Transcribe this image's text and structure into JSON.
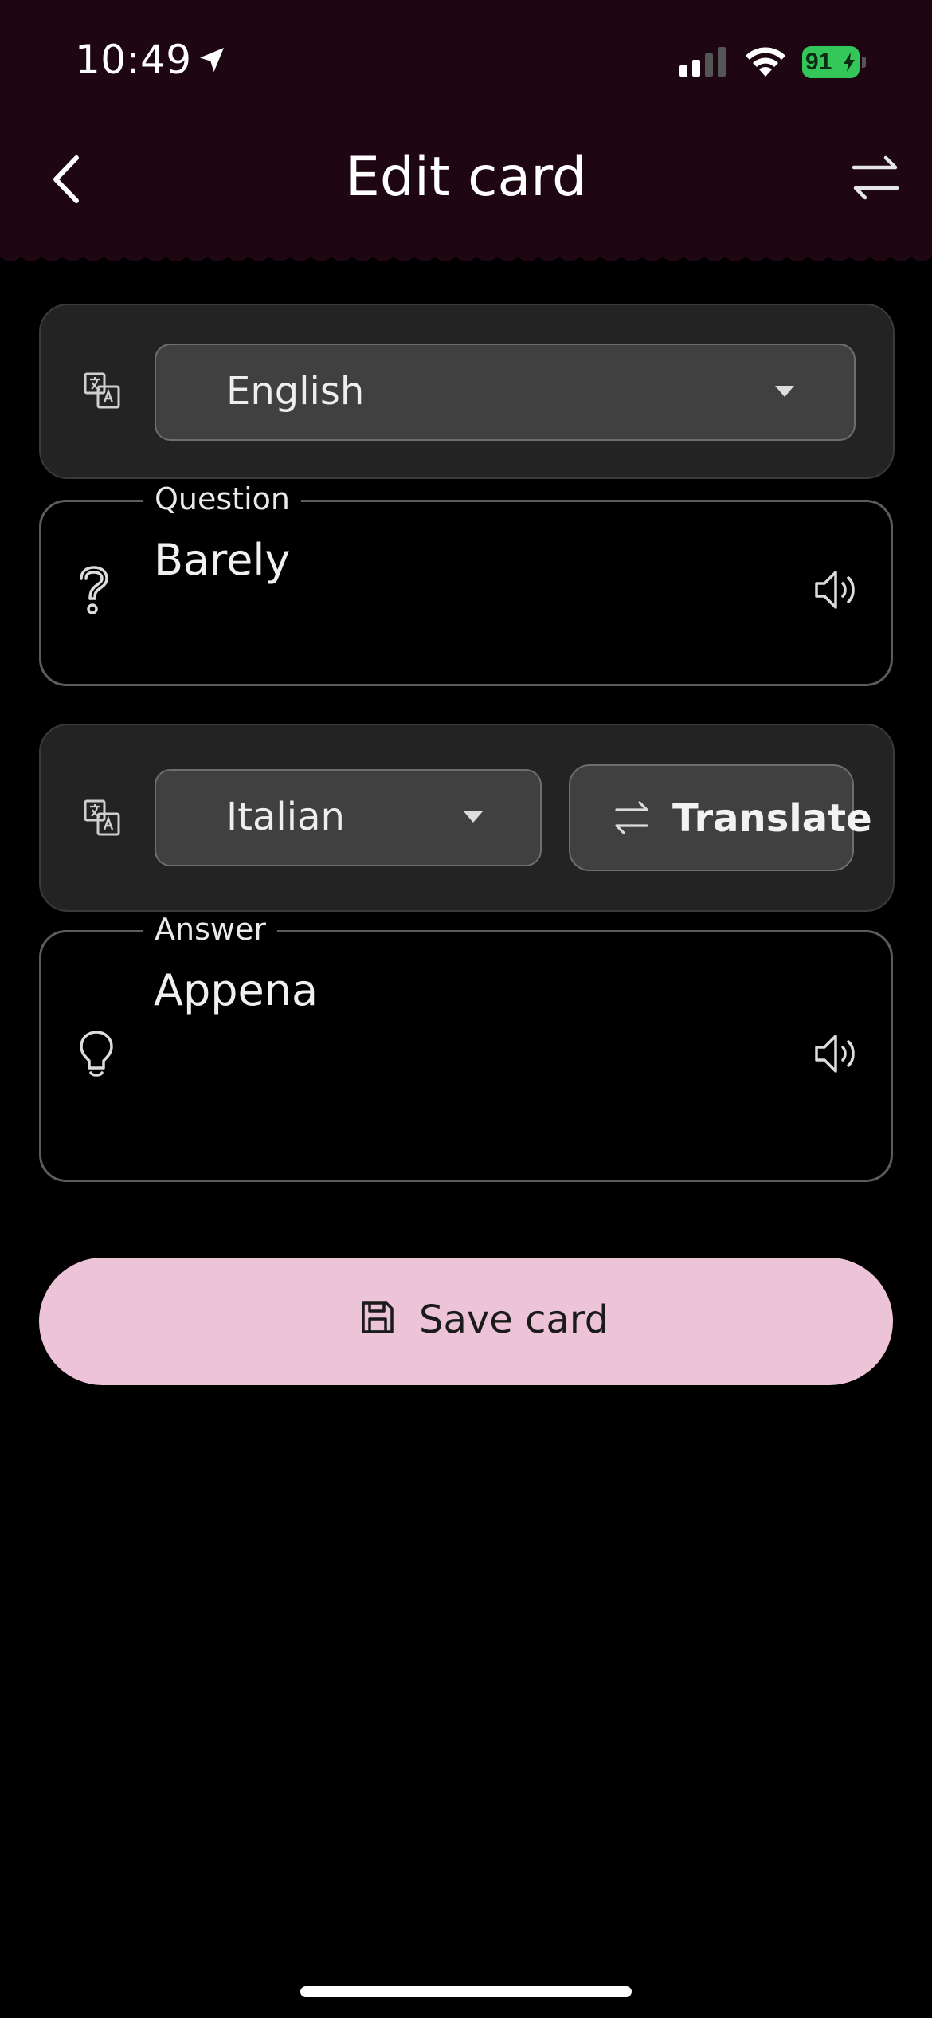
{
  "status_bar": {
    "time": "10:49",
    "battery": "91"
  },
  "header": {
    "title": "Edit card"
  },
  "question_language": {
    "selected": "English"
  },
  "question": {
    "legend": "Question",
    "value": "Barely"
  },
  "answer_language": {
    "selected": "Italian"
  },
  "translate": {
    "label": "Translate"
  },
  "answer": {
    "legend": "Answer",
    "value": "Appena"
  },
  "save": {
    "label": "Save card"
  },
  "colors": {
    "header_bg": "#1e0612",
    "accent": "#edc3d7",
    "panel": "#232323",
    "battery": "#33c759"
  }
}
